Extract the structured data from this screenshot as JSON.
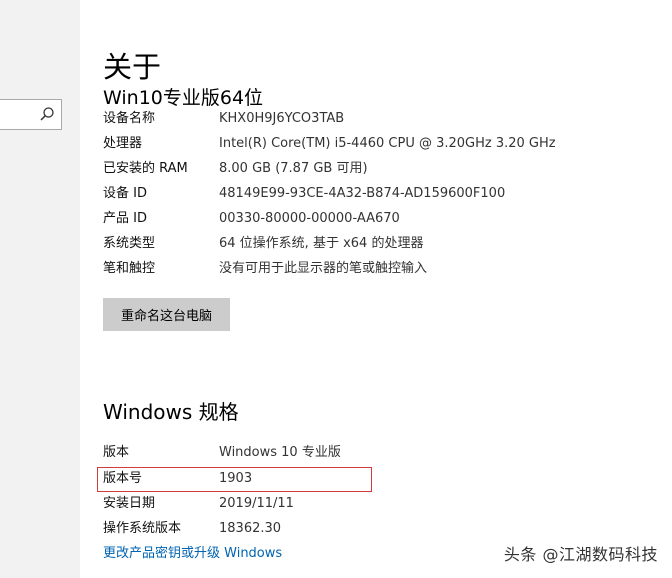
{
  "about": {
    "title": "关于",
    "edition_heading": "Win10专业版64位"
  },
  "device_specs": [
    {
      "label": "设备名称",
      "value": "KHX0H9J6YCO3TAB"
    },
    {
      "label": "处理器",
      "value": "Intel(R) Core(TM) i5-4460  CPU @ 3.20GHz   3.20 GHz"
    },
    {
      "label": "已安装的 RAM",
      "value": "8.00 GB (7.87 GB 可用)"
    },
    {
      "label": "设备 ID",
      "value": "48149E99-93CE-4A32-B874-AD159600F100"
    },
    {
      "label": "产品 ID",
      "value": "00330-80000-00000-AA670"
    },
    {
      "label": "系统类型",
      "value": "64 位操作系统, 基于 x64 的处理器"
    },
    {
      "label": "笔和触控",
      "value": "没有可用于此显示器的笔或触控输入"
    }
  ],
  "rename_button": "重命名这台电脑",
  "windows_specs_title": "Windows 规格",
  "windows_specs": [
    {
      "label": "版本",
      "value": "Windows 10 专业版"
    },
    {
      "label": "版本号",
      "value": "1903"
    },
    {
      "label": "安装日期",
      "value": "2019/11/11"
    },
    {
      "label": "操作系统版本",
      "value": "18362.30"
    }
  ],
  "upgrade_link": "更改产品密钥或升级 Windows",
  "watermark": "头条 @江湖数码科技",
  "icons": {
    "search": "search-icon"
  },
  "colors": {
    "link": "#0063b1",
    "highlight_border": "#d23b3b",
    "button": "#cccccc",
    "sidebar": "#f2f2f2"
  }
}
